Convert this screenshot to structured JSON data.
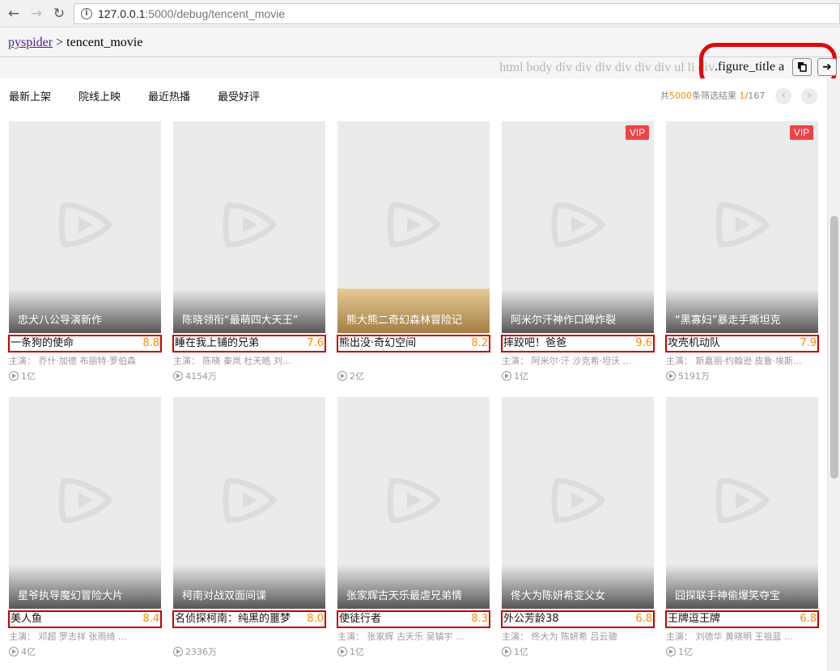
{
  "browser": {
    "url_host": "127.0.0.1",
    "url_path": ":5000/debug/tencent_movie"
  },
  "header": {
    "project_link": "pyspider",
    "separator": " > ",
    "project_name": "tencent_movie"
  },
  "selector_bar": {
    "path_chain": "html  body  div  div  div  div  div  div  ul  li  div",
    "selector": ".figure_title  a"
  },
  "tabs": [
    "最新上架",
    "院线上映",
    "最近热播",
    "最受好评"
  ],
  "results": {
    "prefix": "共",
    "count": "5000",
    "middle": "条筛选结果 ",
    "page": "1",
    "total_pages": "/167"
  },
  "movies": [
    {
      "caption": "忠犬八公导演新作",
      "title": "一条狗的使命",
      "score": "8.8",
      "cast": "主演：  乔什·加德    布丽特·罗伯森",
      "plays": "1亿",
      "vip": "",
      "gold": false
    },
    {
      "caption": "陈晓领衔“最萌四大天王”",
      "title": "睡在我上铺的兄弟",
      "score": "7.6",
      "cast": "主演：  陈晓    秦岚    杜天皓    刘...",
      "plays": "4154万",
      "vip": "",
      "gold": false
    },
    {
      "caption": "熊大熊二奇幻森林冒险记",
      "title": "熊出没·奇幻空间",
      "score": "8.2",
      "cast": "",
      "plays": "2亿",
      "vip": "",
      "gold": true
    },
    {
      "caption": "阿米尔汗神作口碑炸裂",
      "title": "摔跤吧！爸爸",
      "score": "9.6",
      "cast": "主演：  阿米尔·汗    沙克希·坦沃    ...",
      "plays": "1亿",
      "vip": "VIP",
      "gold": false
    },
    {
      "caption": "“黑寡妇”暴走手撕坦克",
      "title": "攻壳机动队",
      "score": "7.9",
      "cast": "主演：  斯嘉丽·约翰逊    皮鲁·埃斯...",
      "plays": "5191万",
      "vip": "VIP",
      "gold": false
    },
    {
      "caption": "星爷执导魔幻冒险大片",
      "title": "美人鱼",
      "score": "8.4",
      "cast": "主演：  邓超    罗志祥    张雨绮    ...",
      "plays": "4亿",
      "vip": "",
      "gold": false
    },
    {
      "caption": "柯南对战双面间谍",
      "title": "名侦探柯南：纯黑的噩梦",
      "score": "8.0",
      "cast": "",
      "plays": "2336万",
      "vip": "",
      "gold": false
    },
    {
      "caption": "张家辉古天乐最虐兄弟情",
      "title": "使徒行者",
      "score": "8.3",
      "cast": "主演：  张家辉    古天乐    吴镇宇  ...",
      "plays": "1亿",
      "vip": "",
      "gold": false
    },
    {
      "caption": "佟大为陈妍希变父女",
      "title": "外公芳龄38",
      "score": "6.8",
      "cast": "主演：  佟大为    陈妍希    吕云骢",
      "plays": "1亿",
      "vip": "",
      "gold": false
    },
    {
      "caption": "囧探联手神偷爆笑夺宝",
      "title": "王牌逗王牌",
      "score": "6.8",
      "cast": "主演：  刘德华    黄晓明    王祖蓝  ...",
      "plays": "1亿",
      "vip": "",
      "gold": false
    }
  ],
  "colors": {
    "score": "#ff8a00",
    "vip": "#f0424a",
    "highlight_border": "#c40000"
  }
}
